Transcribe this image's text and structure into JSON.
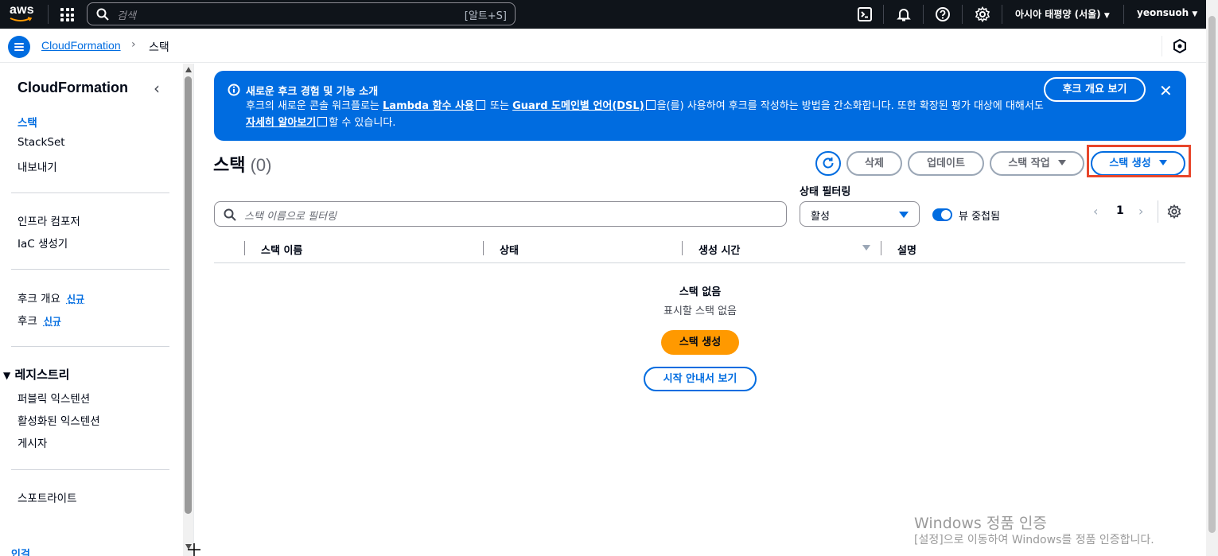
{
  "topnav": {
    "logo": "aws",
    "search_placeholder": "검색",
    "search_shortcut": "[알트+S]",
    "icons": [
      "grid-icon",
      "cloudshell-icon",
      "bell-icon",
      "help-icon",
      "settings-icon"
    ],
    "region": "아시아 태평양 (서울)",
    "user": "yeonsuoh"
  },
  "breadcrumb": {
    "service": "CloudFormation",
    "current": "스택"
  },
  "sidebar": {
    "title": "CloudFormation",
    "group1": [
      "스택",
      "StackSet",
      "내보내기"
    ],
    "group2": [
      "인프라 컴포저",
      "IaC 생성기"
    ],
    "group3": [
      {
        "label": "후크 개요",
        "badge": "신규"
      },
      {
        "label": "후크",
        "badge": "신규"
      }
    ],
    "registry_title": "레지스트리",
    "registry_items": [
      "퍼블릭 익스텐션",
      "활성화된 익스텐션",
      "게시자"
    ],
    "group5": [
      "스포트라이트"
    ],
    "cut_off_item": "인걸"
  },
  "flash": {
    "title": "새로운 후크 경험 및 기능 소개",
    "body_1": "후크의 새로운 콘솔 워크플로는 ",
    "link_1": "Lambda 함수 사용",
    "body_2": " 또는 ",
    "link_2": "Guard 도메인별 언어(DSL)",
    "body_3": "을(를) 사용하여 후크를 작성하는 방법을 간소화합니다. 또한 확장된 평가 대상에 대해서도 ",
    "link_3": "자세히 알아보기",
    "body_4": "할 수 있습니다.",
    "button": "후크 개요 보기"
  },
  "header": {
    "title": "스택",
    "count": "(0)",
    "delete": "삭제",
    "update": "업데이트",
    "stack_actions": "스택 작업",
    "create_stack": "스택 생성"
  },
  "filters": {
    "search_placeholder": "스택 이름으로 필터링",
    "status_label": "상태 필터링",
    "status_value": "활성",
    "nested_view": "뷰 중첩됨",
    "page": "1"
  },
  "table": {
    "columns": [
      "스택 이름",
      "상태",
      "생성 시간",
      "설명"
    ]
  },
  "empty": {
    "title": "스택 없음",
    "subtitle": "표시할 스택 없음",
    "create_button": "스택 생성",
    "guide_button": "시작 안내서 보기"
  },
  "watermark": {
    "line1": "Windows 정품 인증",
    "line2": "[설정]으로 이동하여 Windows를 정품 인증합니다."
  }
}
